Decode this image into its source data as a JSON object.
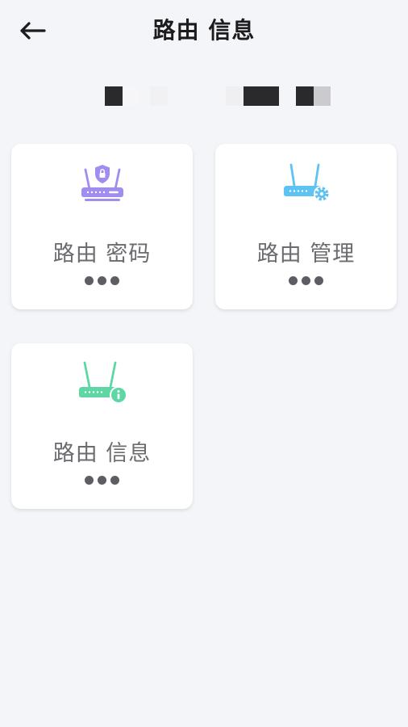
{
  "header": {
    "title": "路由 信息"
  },
  "cards": [
    {
      "label": "路由 密码",
      "icon": "router-lock-icon",
      "color": "#a18cf0"
    },
    {
      "label": "路由 管理",
      "icon": "router-gear-icon",
      "color": "#5ec3f3"
    },
    {
      "label": "路由 信息",
      "icon": "router-info-icon",
      "color": "#5ed7a5"
    }
  ],
  "colors": {
    "background": "#f4f5f9",
    "title": "#1c1c1e",
    "label": "#6b6b70",
    "dots": "#5d5d63"
  }
}
